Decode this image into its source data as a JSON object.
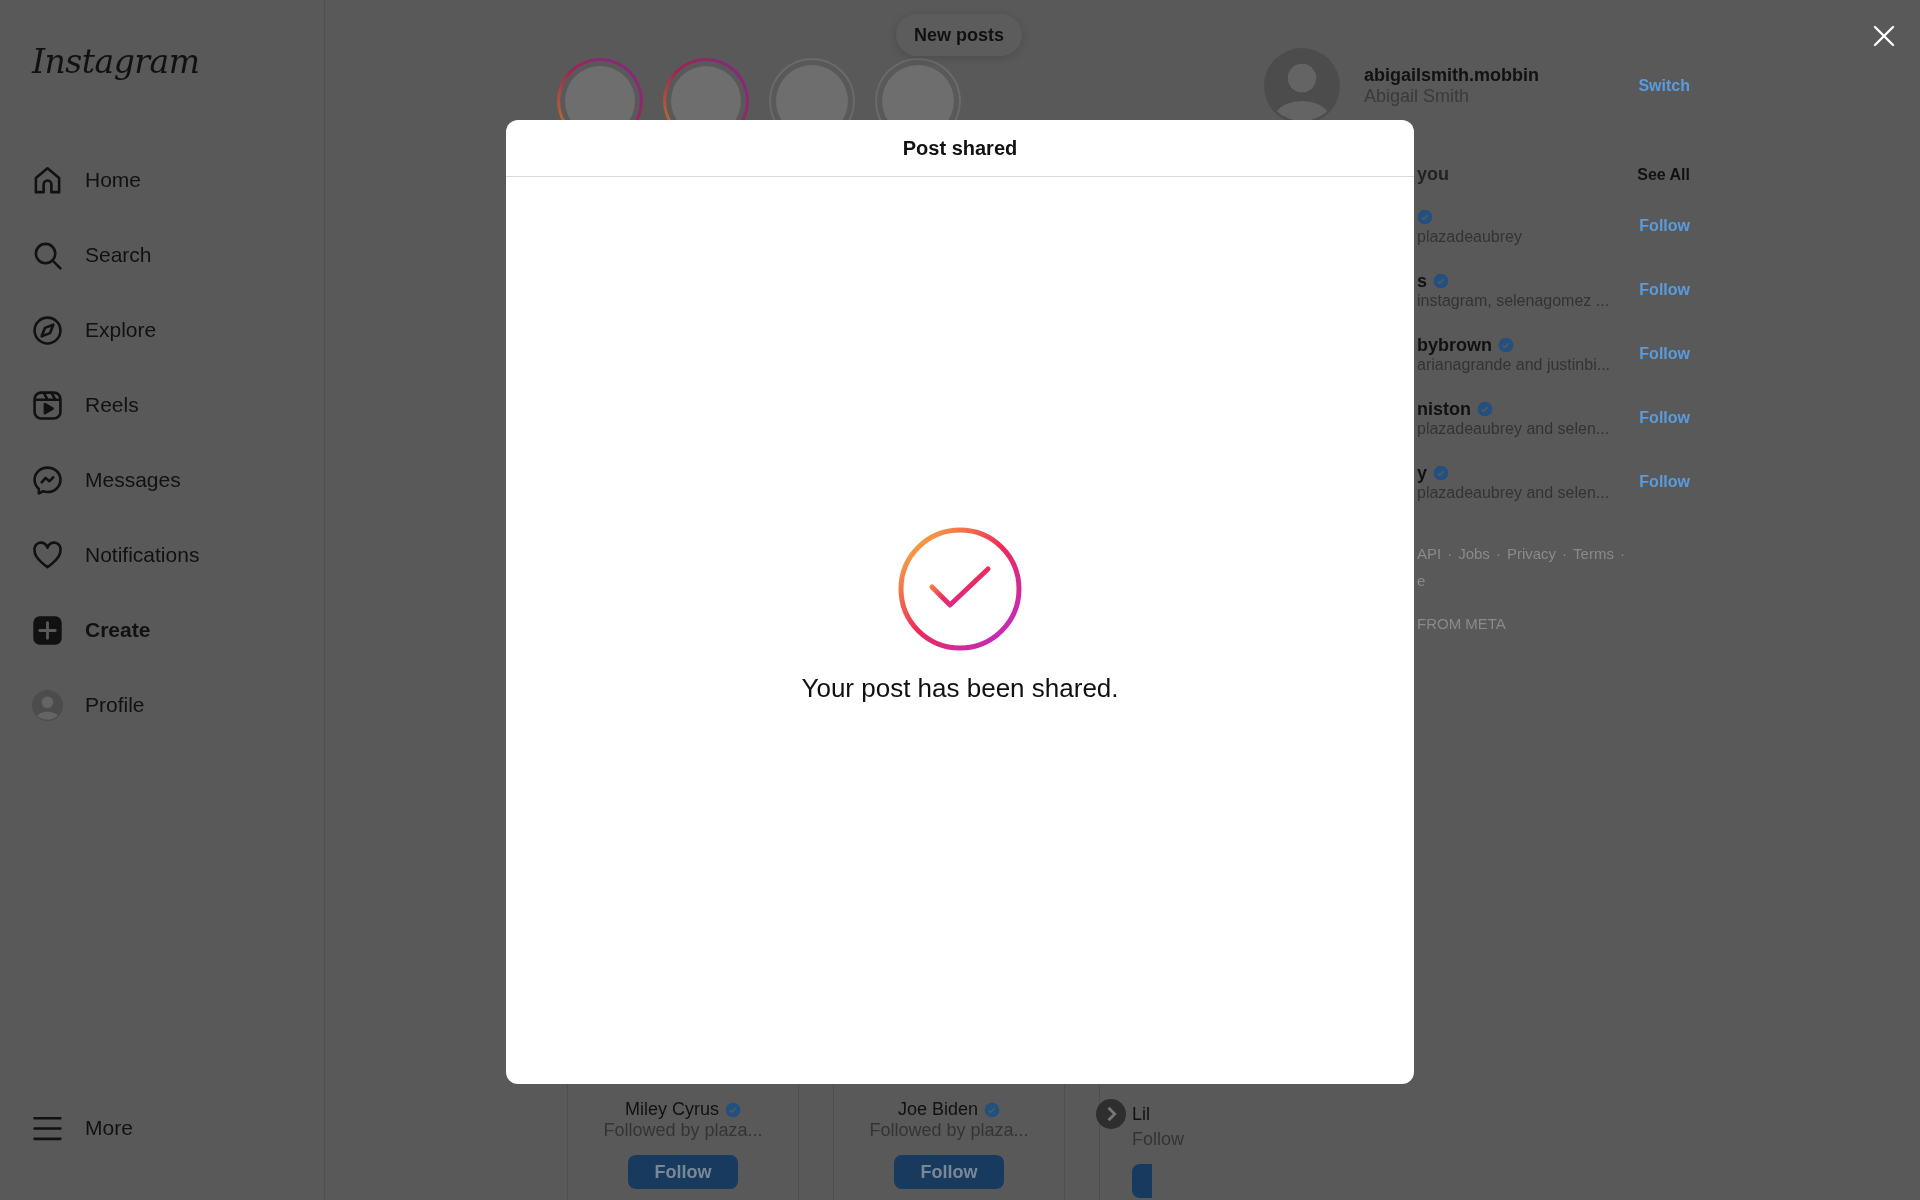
{
  "sidebar": {
    "logo": "Instagram",
    "items": [
      {
        "label": "Home",
        "selected": false
      },
      {
        "label": "Search",
        "selected": false
      },
      {
        "label": "Explore",
        "selected": false
      },
      {
        "label": "Reels",
        "selected": false
      },
      {
        "label": "Messages",
        "selected": false
      },
      {
        "label": "Notifications",
        "selected": false
      },
      {
        "label": "Create",
        "selected": true
      },
      {
        "label": "Profile",
        "selected": false
      }
    ],
    "more": "More"
  },
  "new_posts_button": "New posts",
  "stories": [
    {
      "unseen": true
    },
    {
      "unseen": true
    },
    {
      "unseen": false
    },
    {
      "unseen": false
    }
  ],
  "account": {
    "username": "abigailsmith.mobbin",
    "name": "Abigail Smith",
    "action": "Switch"
  },
  "suggestions": {
    "heading": "you",
    "see_all": "See All",
    "items": [
      {
        "verified": true,
        "subtitle": "plazadeaubrey",
        "action": "Follow"
      },
      {
        "name": "s",
        "verified": true,
        "subtitle": "instagram, selenagomez ...",
        "action": "Follow"
      },
      {
        "name": "bybrown",
        "verified": true,
        "subtitle": "arianagrande and justinbi...",
        "action": "Follow"
      },
      {
        "name": "niston",
        "verified": true,
        "subtitle": "plazadeaubrey and selen...",
        "action": "Follow"
      },
      {
        "name": "y",
        "verified": true,
        "subtitle": "plazadeaubrey and selen...",
        "action": "Follow"
      }
    ]
  },
  "footer": {
    "links": [
      "API",
      "Jobs",
      "Privacy",
      "Terms"
    ],
    "separator": "·",
    "line_2": "e",
    "credit": "FROM META"
  },
  "suggested_cards": [
    {
      "name": "Miley Cyrus",
      "verified": true,
      "subtitle": "Followed by plaza...",
      "action": "Follow"
    },
    {
      "name": "Joe Biden",
      "verified": true,
      "subtitle": "Followed by plaza...",
      "action": "Follow"
    },
    {
      "name": "Lil",
      "verified": false,
      "subtitle": "Follow"
    }
  ],
  "modal": {
    "title": "Post shared",
    "message": "Your post has been shared."
  }
}
